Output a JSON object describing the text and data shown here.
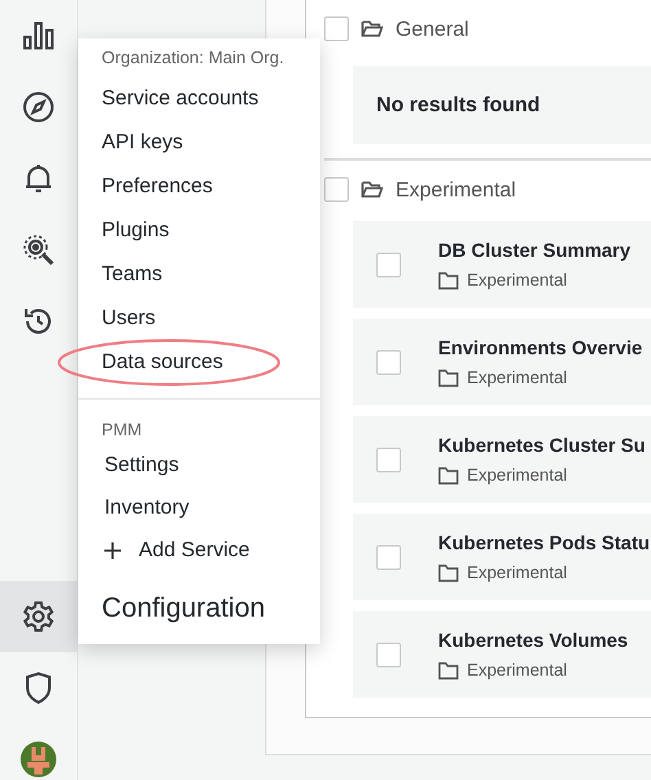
{
  "sidebar": {
    "items": [
      {
        "selected": false
      },
      {
        "selected": false
      },
      {
        "selected": false
      },
      {
        "selected": false
      },
      {
        "selected": false
      },
      {
        "selected": true
      },
      {
        "selected": false
      }
    ]
  },
  "menu": {
    "header": "Organization: Main Org.",
    "items": [
      {
        "label": "Service accounts",
        "highlighted": false
      },
      {
        "label": "API keys",
        "highlighted": false
      },
      {
        "label": "Preferences",
        "highlighted": false
      },
      {
        "label": "Plugins",
        "highlighted": false
      },
      {
        "label": "Teams",
        "highlighted": false
      },
      {
        "label": "Users",
        "highlighted": false
      },
      {
        "label": "Data sources",
        "highlighted": true
      }
    ],
    "section": "PMM",
    "section_items": [
      {
        "label": "Settings",
        "kind": "link"
      },
      {
        "label": "Inventory",
        "kind": "link"
      },
      {
        "label": "Add Service",
        "kind": "add"
      }
    ],
    "title": "Configuration"
  },
  "folders": [
    {
      "name": "General",
      "checked": false,
      "empty_text": "No results found"
    },
    {
      "name": "Experimental",
      "checked": false,
      "dashboards": [
        {
          "title": "DB Cluster Summary",
          "folder": "Experimental",
          "checked": false
        },
        {
          "title": "Environments Overvie",
          "folder": "Experimental",
          "checked": false
        },
        {
          "title": "Kubernetes Cluster Su",
          "folder": "Experimental",
          "checked": false
        },
        {
          "title": "Kubernetes Pods Statu",
          "folder": "Experimental",
          "checked": false
        },
        {
          "title": "Kubernetes Volumes",
          "folder": "Experimental",
          "checked": false
        }
      ]
    }
  ]
}
